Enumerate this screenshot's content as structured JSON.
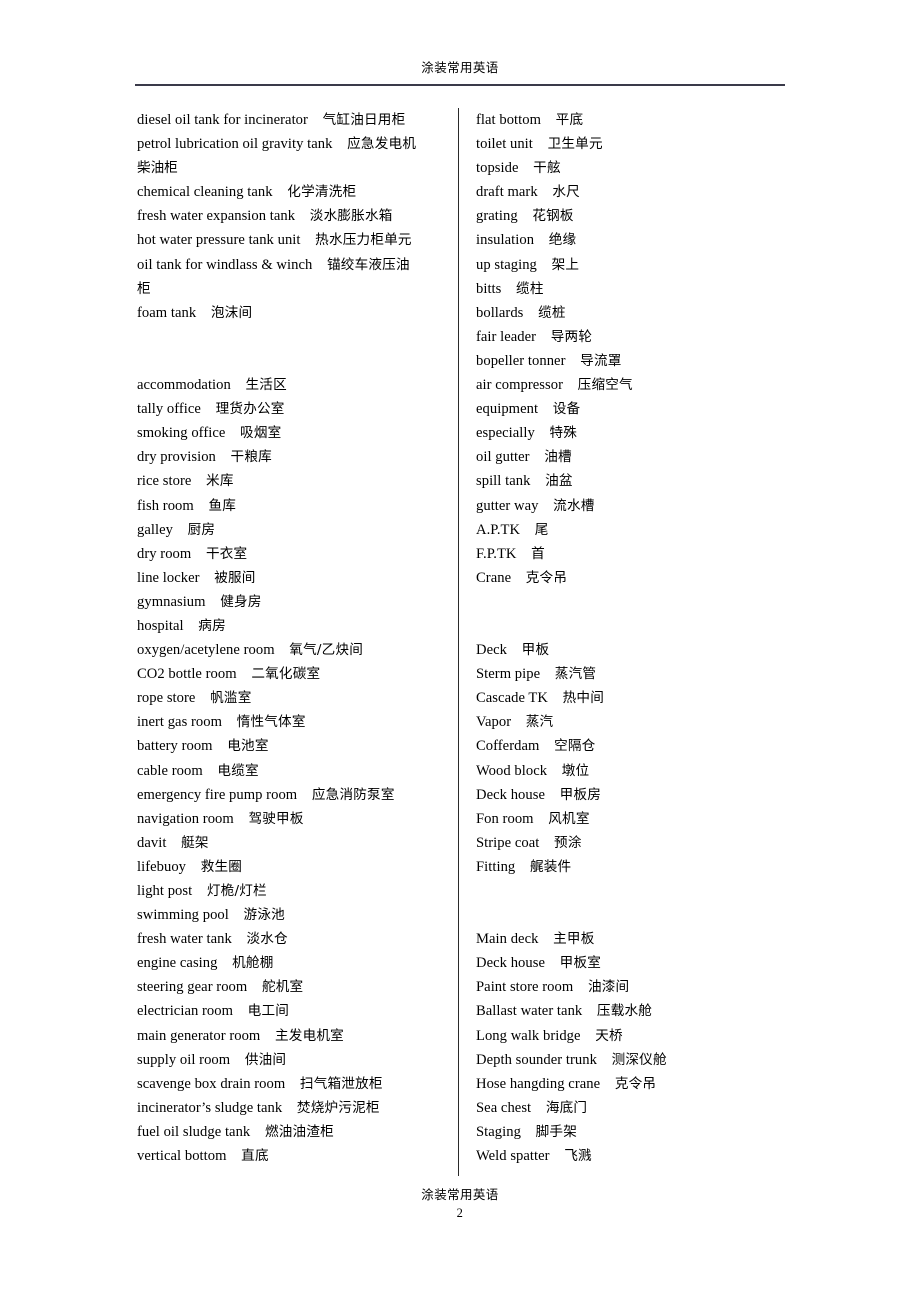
{
  "header": {
    "running_title": "涂装常用英语"
  },
  "footer": {
    "running_title": "涂装常用英语",
    "page_number": "2"
  },
  "left_column": {
    "groups": [
      {
        "entries": [
          {
            "en": "diesel oil tank for incinerator",
            "zh": "气缸油日用柜"
          },
          {
            "en": "petrol lubrication oil gravity tank",
            "zh": "应急发电机",
            "zh_cont": "柴油柜"
          },
          {
            "en": "chemical cleaning tank",
            "zh": "化学清洗柜"
          },
          {
            "en": "fresh water expansion tank",
            "zh": "淡水膨胀水箱"
          },
          {
            "en": "hot water pressure tank unit",
            "zh": "热水压力柜单元"
          },
          {
            "en": "oil tank for windlass & winch",
            "zh": "锚绞车液压油",
            "zh_cont": "柜"
          },
          {
            "en": "foam tank",
            "zh": "泡沫间"
          }
        ]
      },
      {
        "entries": [
          {
            "en": "accommodation",
            "zh": "生活区"
          },
          {
            "en": "tally office",
            "zh": "理货办公室"
          },
          {
            "en": "smoking office",
            "zh": "吸烟室"
          },
          {
            "en": "dry provision",
            "zh": "干粮库"
          },
          {
            "en": "rice store",
            "zh": "米库"
          },
          {
            "en": "fish room",
            "zh": "鱼库"
          },
          {
            "en": "galley",
            "zh": "厨房"
          },
          {
            "en": "dry room",
            "zh": "干衣室"
          },
          {
            "en": "line locker",
            "zh": "被服间"
          },
          {
            "en": "gymnasium",
            "zh": "健身房"
          },
          {
            "en": "hospital",
            "zh": "病房"
          },
          {
            "en": "oxygen/acetylene room",
            "zh": "氧气/乙炔间"
          },
          {
            "en": "CO2 bottle room",
            "zh": "二氧化碳室"
          },
          {
            "en": "rope store",
            "zh": "帆滥室"
          },
          {
            "en": "inert gas room",
            "zh": "惰性气体室"
          },
          {
            "en": "battery room",
            "zh": "电池室"
          },
          {
            "en": "cable room",
            "zh": "电缆室"
          },
          {
            "en": "emergency fire pump room",
            "zh": "应急消防泵室"
          },
          {
            "en": "navigation room",
            "zh": "驾驶甲板"
          },
          {
            "en": "davit",
            "zh": "艇架"
          },
          {
            "en": "lifebuoy",
            "zh": "救生圈"
          },
          {
            "en": "light post",
            "zh": "灯桅/灯栏"
          },
          {
            "en": "swimming pool",
            "zh": "游泳池"
          },
          {
            "en": "fresh water tank",
            "zh": "淡水仓"
          },
          {
            "en": "engine casing",
            "zh": "机舱棚"
          },
          {
            "en": "steering gear room",
            "zh": "舵机室"
          },
          {
            "en": "electrician room",
            "zh": "电工间"
          },
          {
            "en": "main generator room",
            "zh": "主发电机室"
          },
          {
            "en": "supply oil room",
            "zh": "供油间"
          },
          {
            "en": "scavenge box drain room",
            "zh": "扫气箱泄放柜"
          },
          {
            "en": "incinerator’s sludge tank",
            "zh": "焚烧炉污泥柜"
          },
          {
            "en": "fuel oil sludge tank",
            "zh": "燃油油渣柜"
          },
          {
            "en": "vertical bottom",
            "zh": "直底"
          }
        ]
      }
    ]
  },
  "right_column": {
    "groups": [
      {
        "entries": [
          {
            "en": "flat bottom",
            "zh": "平底"
          },
          {
            "en": "toilet unit",
            "zh": "卫生单元"
          },
          {
            "en": "topside",
            "zh": "干舷"
          },
          {
            "en": "draft mark",
            "zh": "水尺"
          },
          {
            "en": "grating",
            "zh": "花钢板"
          },
          {
            "en": "insulation",
            "zh": "绝缘"
          },
          {
            "en": "up staging",
            "zh": "架上"
          },
          {
            "en": "bitts",
            "zh": "缆柱"
          },
          {
            "en": "bollards",
            "zh": "缆桩"
          },
          {
            "en": "fair leader",
            "zh": "导两轮"
          },
          {
            "en": "bopeller tonner",
            "zh": "导流罩"
          },
          {
            "en": "air compressor",
            "zh": "压缩空气"
          },
          {
            "en": "equipment",
            "zh": "设备"
          },
          {
            "en": "especially",
            "zh": "特殊"
          },
          {
            "en": "oil gutter",
            "zh": "油槽"
          },
          {
            "en": "spill tank",
            "zh": "油盆"
          },
          {
            "en": "gutter way",
            "zh": "流水槽"
          },
          {
            "en": "A.P.TK",
            "zh": "尾"
          },
          {
            "en": "F.P.TK",
            "zh": "首"
          },
          {
            "en": "Crane",
            "zh": "克令吊"
          }
        ]
      },
      {
        "entries": [
          {
            "en": "Deck",
            "zh": "甲板"
          },
          {
            "en": "Sterm pipe",
            "zh": "蒸汽管"
          },
          {
            "en": "Cascade TK",
            "zh": "热中间"
          },
          {
            "en": "Vapor",
            "zh": "蒸汽"
          },
          {
            "en": "Cofferdam",
            "zh": "空隔仓"
          },
          {
            "en": "Wood block",
            "zh": "墩位"
          },
          {
            "en": "Deck house",
            "zh": "甲板房"
          },
          {
            "en": "Fon room",
            "zh": "风机室"
          },
          {
            "en": "Stripe coat",
            "zh": "预涂"
          },
          {
            "en": "Fitting",
            "zh": "艉装件"
          }
        ]
      },
      {
        "entries": [
          {
            "en": "Main deck",
            "zh": "主甲板"
          },
          {
            "en": "Deck house",
            "zh": "甲板室"
          },
          {
            "en": "Paint store room",
            "zh": "油漆间"
          },
          {
            "en": "Ballast water tank",
            "zh": "压载水舱"
          },
          {
            "en": "Long walk bridge",
            "zh": "天桥"
          },
          {
            "en": "Depth sounder trunk",
            "zh": "测深仪舱"
          },
          {
            "en": "Hose hangding crane",
            "zh": "克令吊"
          },
          {
            "en": "Sea chest",
            "zh": "海底门"
          },
          {
            "en": "Staging",
            "zh": "脚手架"
          },
          {
            "en": "Weld spatter",
            "zh": "飞溅"
          }
        ]
      }
    ]
  }
}
